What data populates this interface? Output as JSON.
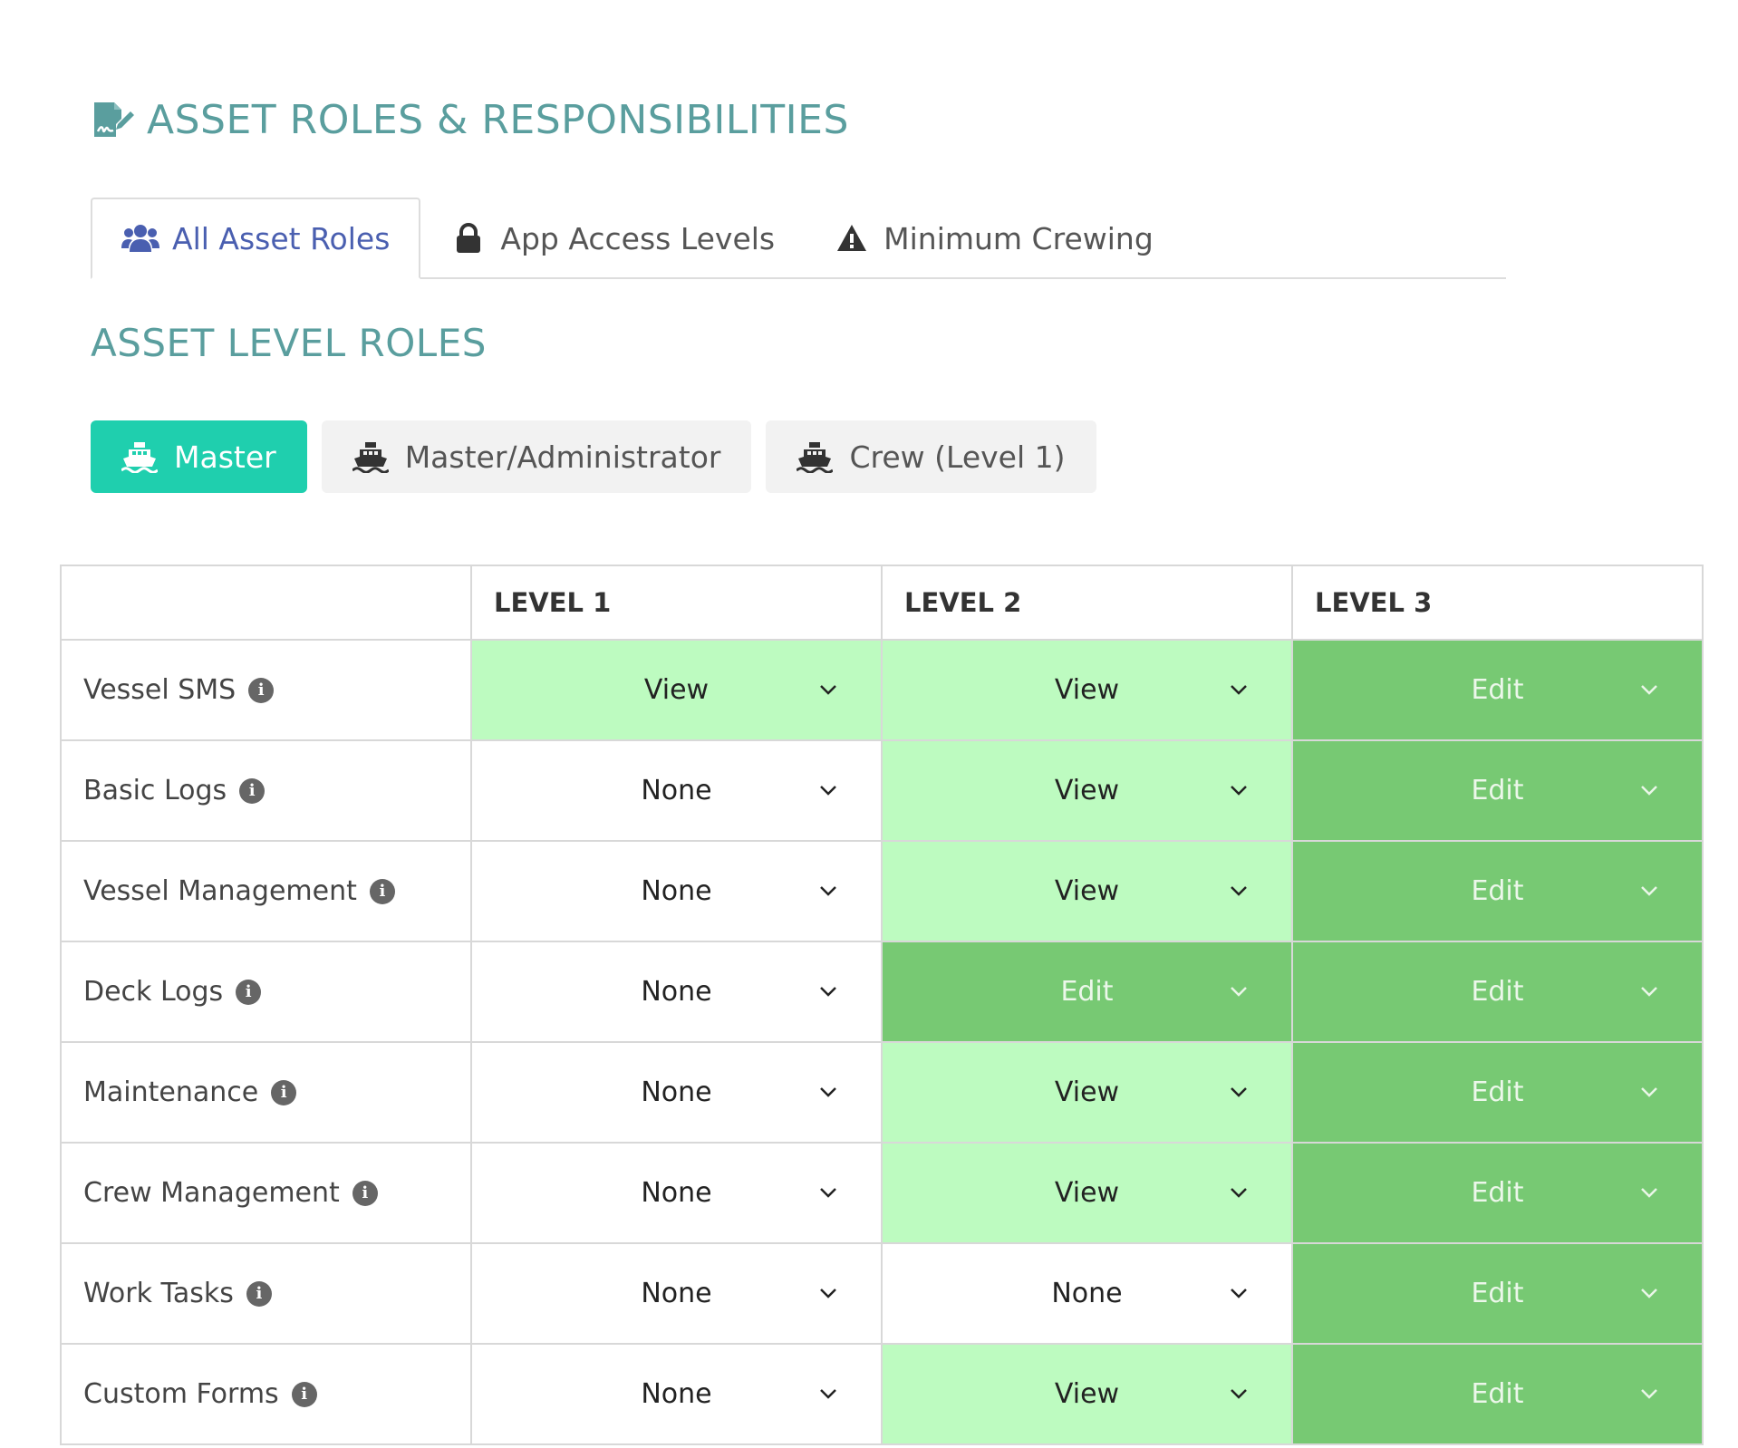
{
  "header": {
    "title": "ASSET ROLES & RESPONSIBILITIES",
    "icon": "file-signature-icon",
    "color": "#5a9e9e"
  },
  "tabs": [
    {
      "label": "All Asset Roles",
      "icon": "users-icon",
      "active": true
    },
    {
      "label": "App Access Levels",
      "icon": "lock-icon",
      "active": false
    },
    {
      "label": "Minimum Crewing",
      "icon": "warning-icon",
      "active": false
    }
  ],
  "section": {
    "title": "ASSET LEVEL ROLES"
  },
  "roles": [
    {
      "label": "Master",
      "icon": "ship-icon",
      "active": true
    },
    {
      "label": "Master/Administrator",
      "icon": "ship-icon",
      "active": false
    },
    {
      "label": "Crew (Level 1)",
      "icon": "ship-icon",
      "active": false
    }
  ],
  "table": {
    "columns": [
      "",
      "LEVEL 1",
      "LEVEL 2",
      "LEVEL 3"
    ],
    "rows": [
      {
        "label": "Vessel SMS",
        "values": [
          "View",
          "View",
          "Edit"
        ]
      },
      {
        "label": "Basic Logs",
        "values": [
          "None",
          "View",
          "Edit"
        ]
      },
      {
        "label": "Vessel Management",
        "values": [
          "None",
          "View",
          "Edit"
        ]
      },
      {
        "label": "Deck Logs",
        "values": [
          "None",
          "Edit",
          "Edit"
        ]
      },
      {
        "label": "Maintenance",
        "values": [
          "None",
          "View",
          "Edit"
        ]
      },
      {
        "label": "Crew Management",
        "values": [
          "None",
          "View",
          "Edit"
        ]
      },
      {
        "label": "Work Tasks",
        "values": [
          "None",
          "None",
          "Edit"
        ]
      },
      {
        "label": "Custom Forms",
        "values": [
          "None",
          "View",
          "Edit"
        ]
      }
    ]
  },
  "colors": {
    "accent": "#1fcfae",
    "tab_active": "#4a5fb0",
    "view": "#bdfbc0",
    "edit": "#77c973",
    "none": "#ffffff"
  }
}
